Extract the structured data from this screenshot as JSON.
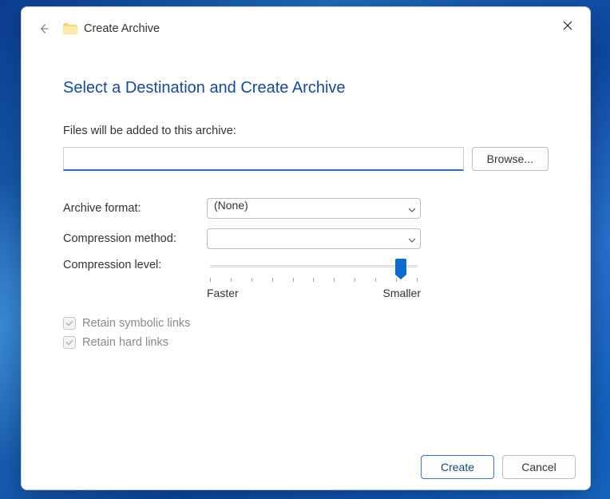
{
  "window": {
    "title": "Create Archive"
  },
  "heading": "Select a Destination and Create Archive",
  "files_label": "Files will be added to this archive:",
  "path_value": "",
  "browse_label": "Browse...",
  "format": {
    "label": "Archive format:",
    "value": "(None)"
  },
  "method": {
    "label": "Compression method:",
    "value": ""
  },
  "level": {
    "label": "Compression level:",
    "left": "Faster",
    "right": "Smaller",
    "ticks": 11,
    "position_percent": 92
  },
  "checks": {
    "symbolic": "Retain symbolic links",
    "hardlinks": "Retain hard links"
  },
  "buttons": {
    "create": "Create",
    "cancel": "Cancel"
  }
}
